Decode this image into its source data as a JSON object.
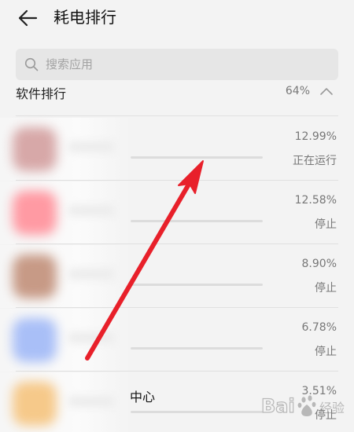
{
  "header": {
    "back_icon": "arrow-left-icon",
    "title": "耗电排行"
  },
  "search": {
    "icon": "search-icon",
    "placeholder": "搜索应用",
    "value": ""
  },
  "section": {
    "title": "软件排行",
    "percent": "64%",
    "expanded_icon": "chevron-up-icon"
  },
  "apps": [
    {
      "name": "",
      "percent": "12.99%",
      "status": "正在运行",
      "icon_color": "#d7a8a8",
      "usage_fraction": 0.1299
    },
    {
      "name": "",
      "percent": "12.58%",
      "status": "停止",
      "icon_color": "#ff9aa3",
      "usage_fraction": 0.1258
    },
    {
      "name": "",
      "percent": "8.90%",
      "status": "停止",
      "icon_color": "#c79a86",
      "usage_fraction": 0.089
    },
    {
      "name": "",
      "percent": "6.78%",
      "status": "停止",
      "icon_color": "#a9bff7",
      "usage_fraction": 0.0678
    },
    {
      "name": "中心",
      "percent": "3.51%",
      "status": "停止",
      "icon_color": "#f6c98a",
      "usage_fraction": 0.0351
    }
  ],
  "annotation": {
    "arrow_color": "#e8202a"
  },
  "watermark": {
    "text": "Bai"
  }
}
